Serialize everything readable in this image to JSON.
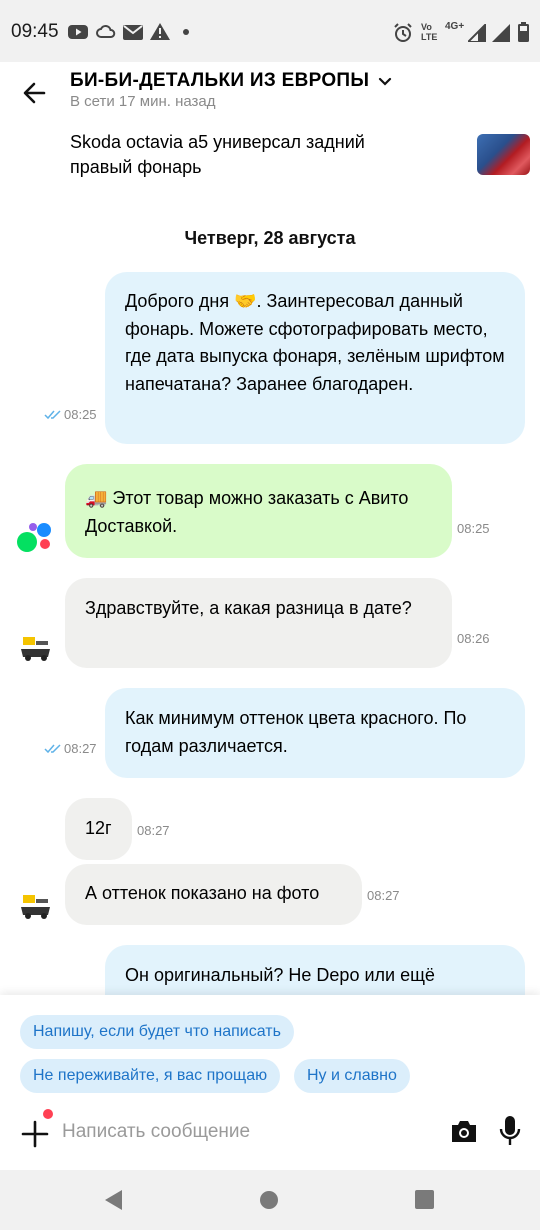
{
  "status_bar": {
    "time": "09:45",
    "icons": [
      "youtube-icon",
      "cloud-icon",
      "mail-icon",
      "warning-icon",
      "dot-icon",
      "alarm-icon",
      "volte-icon",
      "4g-signal-icon",
      "signal-icon",
      "battery-icon"
    ],
    "network_label_1": "Vo",
    "network_label_2": "LTE",
    "network_type": "4G+"
  },
  "header": {
    "title": "БИ-БИ-ДЕТАЛЬКИ ИЗ ЕВРОПЫ",
    "status": "В сети 17 мин. назад",
    "item_title": "Skoda octavia a5 универсал задний правый фонарь"
  },
  "date_separator": "Четверг, 28 августа",
  "messages": [
    {
      "direction": "out",
      "text": "Доброго дня 🤝. Заинтересовал данный фонарь. Можете сфотографировать место, где дата выпуска фонаря, зелёным шрифтом напечатана? Заранее благодарен.",
      "time": "08:25",
      "read": true
    },
    {
      "direction": "system",
      "text": "🚚 Этот товар можно заказать с Авито Доставкой.",
      "time": "08:25"
    },
    {
      "direction": "in",
      "text": "Здравствуйте, а какая разница в дате?",
      "time": "08:26"
    },
    {
      "direction": "out",
      "text": "Как минимум оттенок цвета красного. По годам различается.",
      "time": "08:27",
      "read": true
    },
    {
      "direction": "in",
      "text": "12г",
      "time": "08:27"
    },
    {
      "direction": "in",
      "text": "А оттенок показано на фото",
      "time": "08:27"
    },
    {
      "direction": "out",
      "text": "Он оригинальный? Не Depo или ещё",
      "time": ""
    }
  ],
  "quick_replies": [
    "Напишу, если будет что написать",
    "Не переживайте, я вас прощаю",
    "Ну и славно"
  ],
  "composer": {
    "placeholder": "Написать сообщение"
  },
  "colors": {
    "outgoing_bubble": "#e2f3fc",
    "incoming_bubble": "#f0f0ee",
    "system_bubble": "#d9fbc9",
    "chip_bg": "#dbeefb",
    "chip_text": "#1e74c8",
    "notification_dot": "#ff4053"
  }
}
